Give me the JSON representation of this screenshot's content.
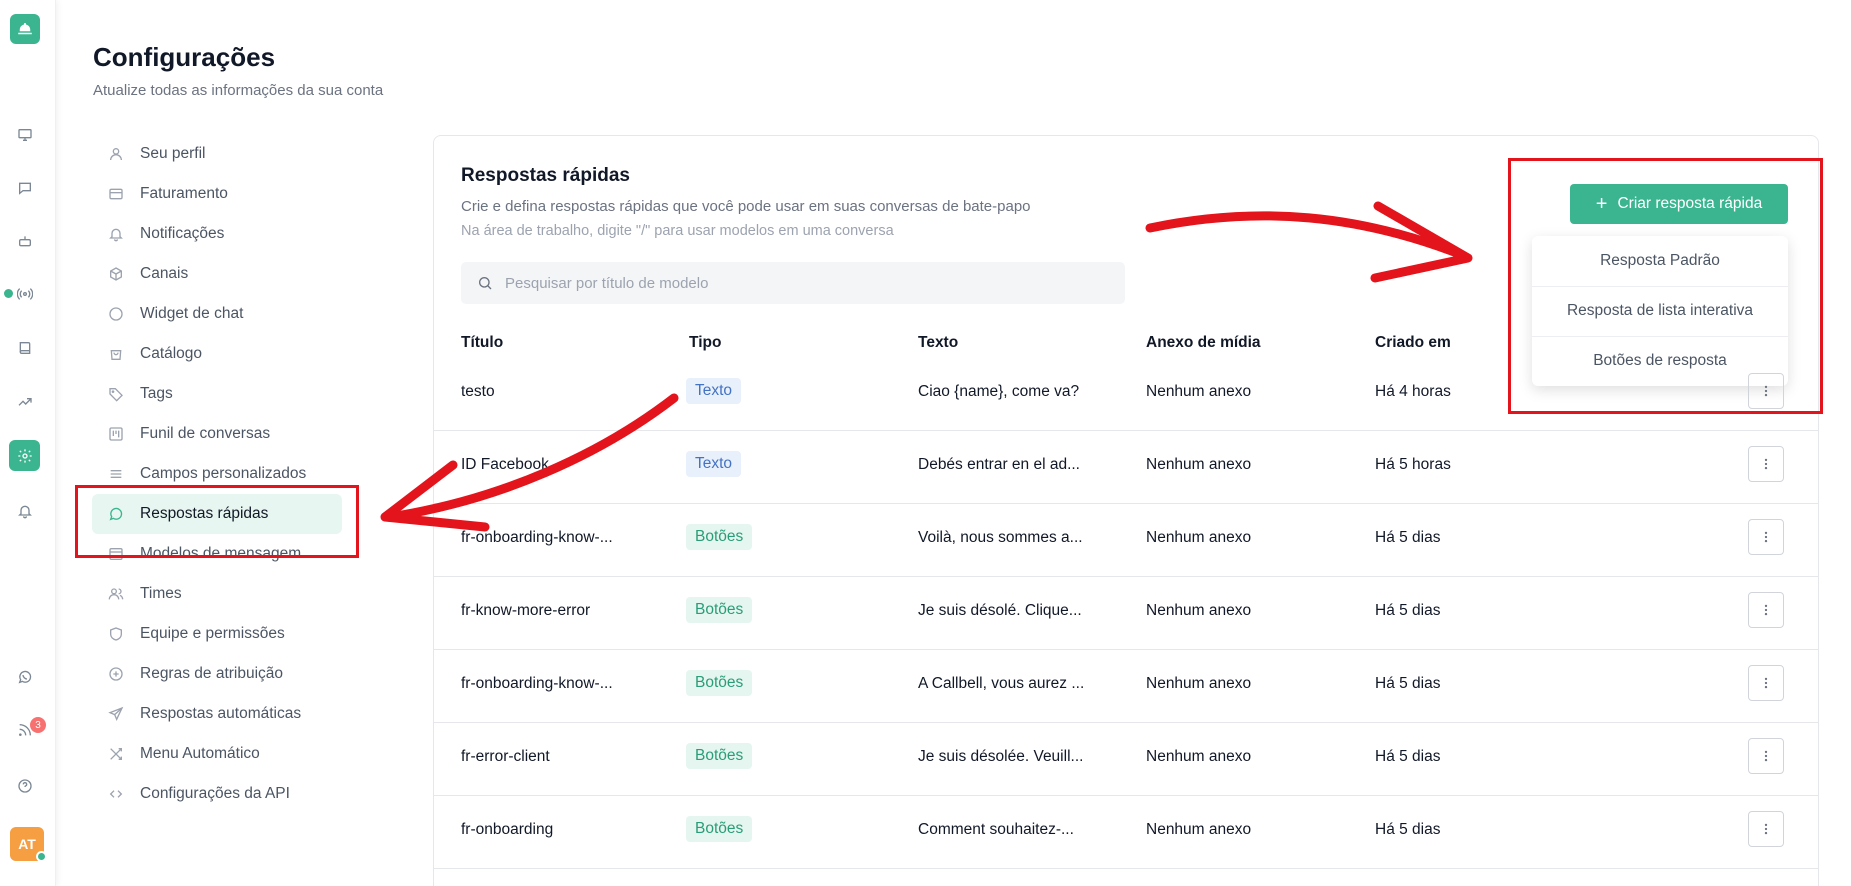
{
  "rail": {
    "avatar_initials": "AT",
    "notification_count": "3",
    "icons": [
      "bell-logo-icon",
      "monitor-icon",
      "chat-icon",
      "bot-icon",
      "broadcast-icon",
      "book-icon",
      "trending-icon",
      "gear-icon",
      "bell-icon",
      "whatsapp-icon",
      "rss-icon",
      "help-icon"
    ]
  },
  "header": {
    "title": "Configurações",
    "subtitle": "Atualize todas as informações da sua conta"
  },
  "settings_nav": {
    "items": [
      {
        "label": "Seu perfil"
      },
      {
        "label": "Faturamento"
      },
      {
        "label": "Notificações"
      },
      {
        "label": "Canais"
      },
      {
        "label": "Widget de chat"
      },
      {
        "label": "Catálogo"
      },
      {
        "label": "Tags"
      },
      {
        "label": "Funil de conversas"
      },
      {
        "label": "Campos personalizados"
      },
      {
        "label": "Respostas rápidas"
      },
      {
        "label": "Modelos de mensagem"
      },
      {
        "label": "Times"
      },
      {
        "label": "Equipe e permissões"
      },
      {
        "label": "Regras de atribuição"
      },
      {
        "label": "Respostas automáticas"
      },
      {
        "label": "Menu Automático"
      },
      {
        "label": "Configurações da API"
      }
    ]
  },
  "panel": {
    "title": "Respostas rápidas",
    "description": "Crie e defina respostas rápidas que você pode usar em suas conversas de bate-papo",
    "hint": "Na área de trabalho, digite \"/\" para usar modelos em uma conversa",
    "search_placeholder": "Pesquisar por título de modelo",
    "create_button": "Criar resposta rápida",
    "create_menu": [
      "Resposta Padrão",
      "Resposta de lista interativa",
      "Botões de resposta"
    ]
  },
  "table": {
    "headers": [
      "Título",
      "Tipo",
      "Texto",
      "Anexo de mídia",
      "Criado em"
    ],
    "rows": [
      {
        "title": "testo",
        "type": "Texto",
        "text": "Ciao {name}, come va?",
        "media": "Nenhum anexo",
        "created": "Há 4 horas"
      },
      {
        "title": "ID Facebook",
        "type": "Texto",
        "text": "Debés entrar en el ad...",
        "media": "Nenhum anexo",
        "created": "Há 5 horas"
      },
      {
        "title": "fr-onboarding-know-...",
        "type": "Botões",
        "text": "Voilà, nous sommes a...",
        "media": "Nenhum anexo",
        "created": "Há 5 dias"
      },
      {
        "title": "fr-know-more-error",
        "type": "Botões",
        "text": "Je suis désolé. Clique...",
        "media": "Nenhum anexo",
        "created": "Há 5 dias"
      },
      {
        "title": "fr-onboarding-know-...",
        "type": "Botões",
        "text": "A Callbell, vous aurez ...",
        "media": "Nenhum anexo",
        "created": "Há 5 dias"
      },
      {
        "title": "fr-error-client",
        "type": "Botões",
        "text": "Je suis désolée. Veuill...",
        "media": "Nenhum anexo",
        "created": "Há 5 dias"
      },
      {
        "title": "fr-onboarding",
        "type": "Botões",
        "text": "Comment souhaitez-...",
        "media": "Nenhum anexo",
        "created": "Há 5 dias"
      }
    ]
  },
  "colors": {
    "accent": "#3bb58f",
    "annotation": "#e3141b"
  }
}
